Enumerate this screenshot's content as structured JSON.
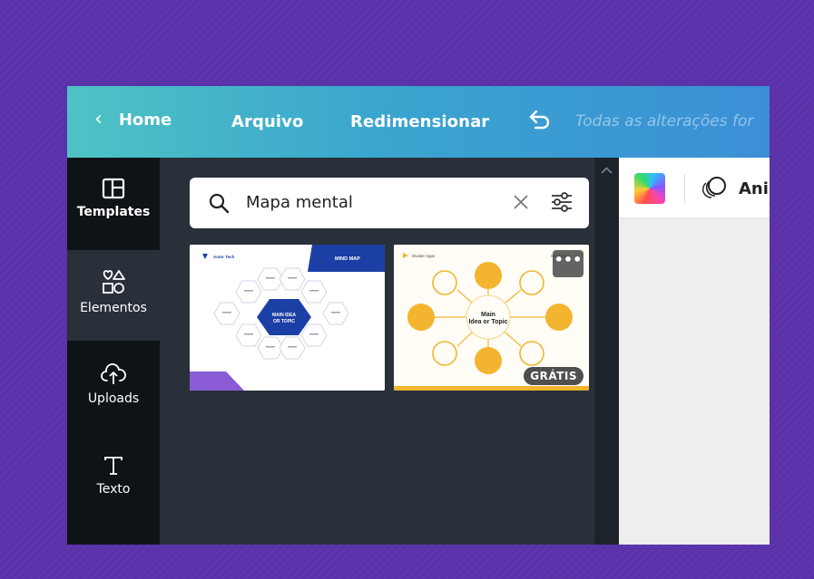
{
  "header": {
    "home_label": "Home",
    "file_label": "Arquivo",
    "resize_label": "Redimensionar",
    "status_text": "Todas as alterações for"
  },
  "sidebar": {
    "items": [
      {
        "label": "Templates",
        "icon": "templates-icon"
      },
      {
        "label": "Elementos",
        "icon": "elements-icon"
      },
      {
        "label": "Uploads",
        "icon": "upload-icon"
      },
      {
        "label": "Texto",
        "icon": "text-icon"
      }
    ]
  },
  "search": {
    "value": "Mapa mental"
  },
  "results": [
    {
      "brand": "Autor Tech",
      "tag": "MIND MAP",
      "center": "MAIN IDEA OR TOPIC"
    },
    {
      "brand": "Divider Apps",
      "tag": "Mind Map",
      "center_line1": "Main",
      "center_line2": "Idea or Topic",
      "badge": "GRÁTIS",
      "more": "•••"
    }
  ],
  "toolbar": {
    "animate_label": "Ani"
  },
  "colors": {
    "accent_purple": "#5a31a8",
    "hex_blue": "#1c3fa5",
    "bubble_yellow": "#f3b52f"
  }
}
